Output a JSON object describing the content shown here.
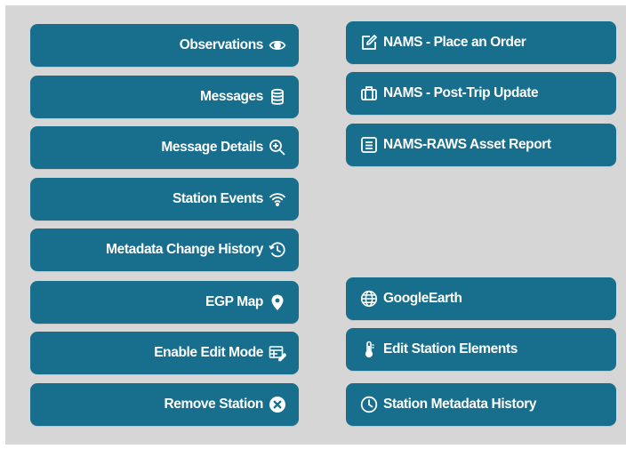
{
  "left_buttons": [
    {
      "label": "Observations",
      "icon": "eye-icon"
    },
    {
      "label": "Messages",
      "icon": "database-icon"
    },
    {
      "label": "Message Details",
      "icon": "zoom-in-icon"
    },
    {
      "label": "Station Events",
      "icon": "wifi-icon"
    },
    {
      "label": "Metadata Change History",
      "icon": "history-icon"
    },
    {
      "label": "EGP Map",
      "icon": "map-pin-icon"
    },
    {
      "label": "Enable Edit Mode",
      "icon": "edit-table-icon"
    },
    {
      "label": "Remove Station",
      "icon": "close-circle-icon"
    }
  ],
  "right_buttons": [
    {
      "label": "NAMS - Place an Order",
      "icon": "pencil-square-icon"
    },
    {
      "label": "NAMS - Post-Trip Update",
      "icon": "suitcase-icon"
    },
    {
      "label": "NAMS-RAWS Asset Report",
      "icon": "list-box-icon"
    },
    {
      "label": "GoogleEarth",
      "icon": "globe-icon"
    },
    {
      "label": "Edit Station Elements",
      "icon": "thermometer-icon"
    },
    {
      "label": "Station Metadata History",
      "icon": "clock-icon"
    }
  ],
  "colors": {
    "button": "#176e8d",
    "background": "#d6d6d6",
    "text": "#ffffff"
  }
}
